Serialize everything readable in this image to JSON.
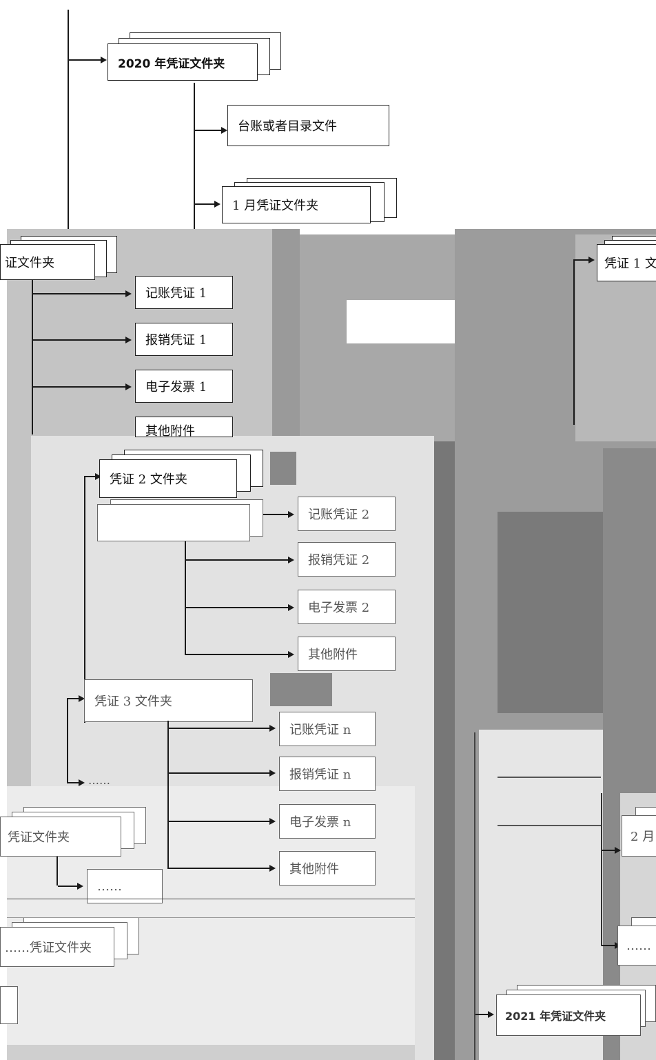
{
  "folders": {
    "year_2020": "2020 年凭证文件夹",
    "ledger_file": "台账或者目录文件",
    "month_1": "1 月凭证文件夹",
    "voucher1_folder_partial": "证文件夹",
    "voucher1_folder_right": "凭证 1 文",
    "voucher2_folder": "凭证 2 文件夹",
    "voucher3_folder": "凭证 3 文件夹",
    "left_voucher_folder": "凭证文件夹",
    "left_ellipsis_folder": "……凭证文件夹",
    "month_2": "2 月",
    "year_2021": "2021 年凭证文件夹"
  },
  "documents": {
    "v1": [
      "记账凭证 1",
      "报销凭证 1",
      "电子发票 1",
      "其他附件"
    ],
    "v2": [
      "记账凭证 2",
      "报销凭证 2",
      "电子发票 2",
      "其他附件"
    ],
    "vn": [
      "记账凭证 n",
      "报销凭证 n",
      "电子发票 n",
      "其他附件"
    ]
  },
  "ellipsis": {
    "dots_short": "……",
    "dots": "……",
    "dots_right": "……"
  },
  "colors": {
    "gray_panel": "#c9c9c9",
    "dark_panel": "#7f7f7f",
    "mid_panel": "#a6a6a6",
    "light_panel": "#e0e0e0",
    "lighter_panel": "#ececec"
  }
}
